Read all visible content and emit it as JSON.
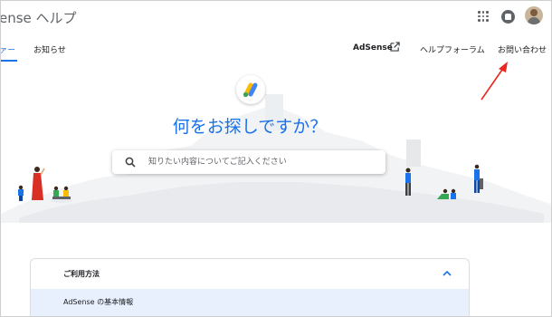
{
  "header": {
    "app_title": "ense ヘルプ",
    "icons": [
      "apps-icon",
      "notifications-icon",
      "avatar"
    ]
  },
  "nav": {
    "partial_tab_label": "ァー",
    "tab_news": "お知らせ",
    "adsense_link": "AdSense",
    "help_forum": "ヘルプフォーラム",
    "contact": "お問い合わせ"
  },
  "hero": {
    "title": "何をお探しですか？",
    "search_placeholder": "知りたい内容についてご記入ください"
  },
  "section": {
    "title": "ご利用方法",
    "items": [
      {
        "label": "AdSense の基本情報"
      }
    ]
  },
  "colors": {
    "accent": "#1a73e8",
    "annotation_arrow": "#e8281f",
    "selected_row": "#e8f0fe",
    "logo_blue": "#4285f4",
    "logo_yellow": "#fbbc04",
    "logo_green": "#34a853"
  }
}
